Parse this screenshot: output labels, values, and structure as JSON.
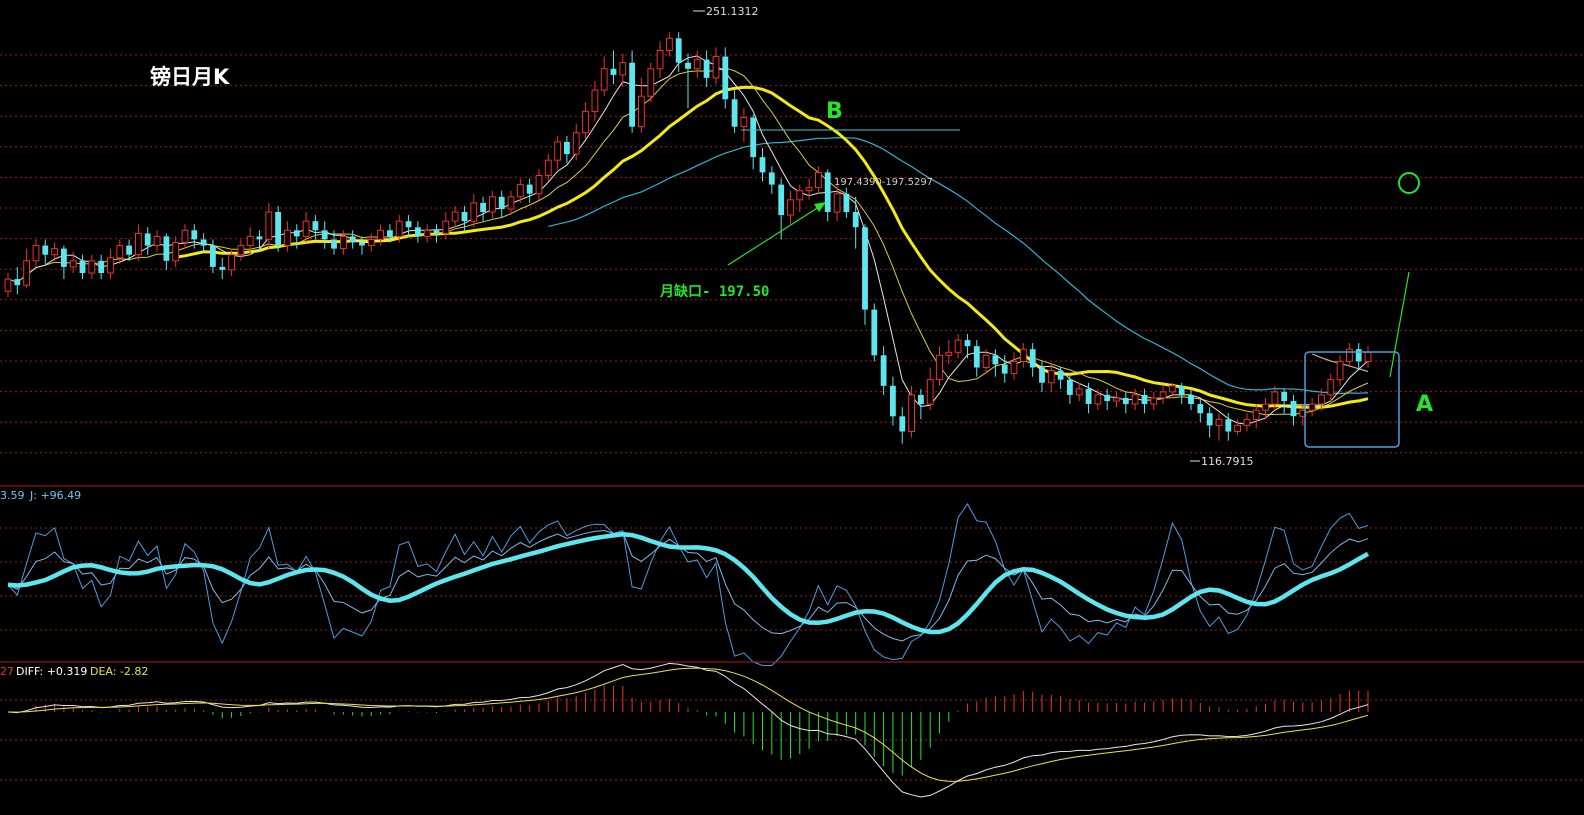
{
  "title": "镑日月K",
  "colors": {
    "background": "#000000",
    "grid": "#9b1c1c",
    "up_candle": "#e8342a",
    "down_candle": "#5ee6ee",
    "ma_white": "#e6e6e6",
    "ma_yellow_thin": "#d8cc3a",
    "ma_yellow_thick": "#f2ea12",
    "ma_blue": "#2fb3d4",
    "ma_grey": "#b9b29a",
    "annotation": "#23e628",
    "kdj_main": "#5ee6ee",
    "macd_pos": "#e8342a",
    "macd_neg": "#23e628"
  },
  "annotations": {
    "high_label": "251.1312",
    "low_label": "116.7915",
    "gap_range_label": "197.4390-197.5297",
    "gap_note": "月缺口- 197.50",
    "point_b": "B",
    "point_a": "A"
  },
  "indicators": {
    "kdj_label_prefix": "3.59",
    "kdj_label_j": "J: +96.49",
    "macd_label_prefix": "27",
    "macd_diff": "DIFF: +0.319",
    "macd_dea": "DEA: -2.82"
  },
  "chart_data": {
    "type": "candlestick",
    "title": "镑日月K",
    "price_range": [
      110,
      255
    ],
    "series_high": 251.1312,
    "series_low": 116.7915,
    "gap": [
      197.439,
      197.5297
    ],
    "candles": [
      [
        166,
        170,
        164,
        172
      ],
      [
        170,
        168,
        165,
        174
      ],
      [
        168,
        176,
        167,
        180
      ],
      [
        176,
        181,
        174,
        183
      ],
      [
        181,
        178,
        175,
        183
      ],
      [
        178,
        180,
        176,
        182
      ],
      [
        180,
        174,
        170,
        181
      ],
      [
        174,
        176,
        172,
        179
      ],
      [
        176,
        172,
        170,
        178
      ],
      [
        172,
        176,
        170,
        178
      ],
      [
        176,
        172,
        170,
        178
      ],
      [
        172,
        177,
        170,
        180
      ],
      [
        177,
        181,
        175,
        183
      ],
      [
        181,
        178,
        176,
        183
      ],
      [
        178,
        185,
        176,
        188
      ],
      [
        185,
        181,
        178,
        187
      ],
      [
        181,
        184,
        179,
        186
      ],
      [
        184,
        176,
        173,
        185
      ],
      [
        176,
        182,
        174,
        184
      ],
      [
        182,
        186,
        180,
        188
      ],
      [
        186,
        183,
        180,
        188
      ],
      [
        183,
        181,
        179,
        185
      ],
      [
        181,
        174,
        172,
        183
      ],
      [
        174,
        173,
        170,
        177
      ],
      [
        173,
        178,
        171,
        180
      ],
      [
        178,
        181,
        176,
        183
      ],
      [
        181,
        184,
        178,
        187
      ],
      [
        184,
        183,
        179,
        186
      ],
      [
        183,
        192,
        180,
        195
      ],
      [
        192,
        181,
        179,
        194
      ],
      [
        181,
        186,
        179,
        189
      ],
      [
        186,
        184,
        180,
        188
      ],
      [
        184,
        189,
        182,
        192
      ],
      [
        189,
        186,
        183,
        191
      ],
      [
        186,
        183,
        180,
        189
      ],
      [
        183,
        180,
        178,
        186
      ],
      [
        180,
        184,
        178,
        186
      ],
      [
        184,
        182,
        180,
        186
      ],
      [
        182,
        181,
        178,
        184
      ],
      [
        181,
        183,
        179,
        185
      ],
      [
        183,
        186,
        181,
        188
      ],
      [
        186,
        184,
        182,
        188
      ],
      [
        184,
        189,
        182,
        191
      ],
      [
        189,
        187,
        184,
        191
      ],
      [
        187,
        184,
        182,
        189
      ],
      [
        184,
        186,
        182,
        188
      ],
      [
        186,
        185,
        182,
        188
      ],
      [
        185,
        189,
        183,
        192
      ],
      [
        189,
        192,
        187,
        194
      ],
      [
        192,
        189,
        186,
        194
      ],
      [
        189,
        195,
        187,
        198
      ],
      [
        195,
        192,
        189,
        197
      ],
      [
        192,
        197,
        190,
        199
      ],
      [
        197,
        193,
        190,
        199
      ],
      [
        193,
        197,
        191,
        199
      ],
      [
        197,
        201,
        195,
        203
      ],
      [
        201,
        198,
        195,
        203
      ],
      [
        198,
        204,
        196,
        206
      ],
      [
        204,
        209,
        202,
        211
      ],
      [
        209,
        215,
        206,
        217
      ],
      [
        215,
        211,
        208,
        217
      ],
      [
        211,
        218,
        209,
        221
      ],
      [
        218,
        225,
        216,
        228
      ],
      [
        225,
        232,
        222,
        235
      ],
      [
        232,
        239,
        230,
        243
      ],
      [
        239,
        237,
        234,
        245
      ],
      [
        237,
        241,
        233,
        244
      ],
      [
        241,
        220,
        218,
        245
      ],
      [
        220,
        230,
        218,
        236
      ],
      [
        230,
        239,
        228,
        241
      ],
      [
        239,
        245,
        236,
        248
      ],
      [
        245,
        249,
        243,
        251
      ],
      [
        249,
        241,
        238,
        251
      ],
      [
        241,
        239,
        226,
        244
      ],
      [
        239,
        242,
        236,
        245
      ],
      [
        242,
        236,
        233,
        245
      ],
      [
        236,
        243,
        234,
        246
      ],
      [
        243,
        229,
        226,
        246
      ],
      [
        229,
        220,
        218,
        232
      ],
      [
        220,
        223,
        215,
        226
      ],
      [
        223,
        210,
        206,
        224
      ],
      [
        210,
        205,
        202,
        213
      ],
      [
        205,
        201,
        198,
        207
      ],
      [
        201,
        191,
        183,
        203
      ],
      [
        191,
        196,
        188,
        199
      ],
      [
        196,
        199,
        192,
        201
      ],
      [
        199,
        200,
        196,
        203
      ],
      [
        200,
        205,
        198,
        207
      ],
      [
        205,
        192,
        189,
        206
      ],
      [
        192,
        198,
        189,
        201
      ],
      [
        198,
        192,
        190,
        200
      ],
      [
        192,
        187,
        180,
        197
      ],
      [
        187,
        160,
        155,
        188
      ],
      [
        160,
        145,
        143,
        162
      ],
      [
        145,
        135,
        132,
        148
      ],
      [
        135,
        125,
        122,
        138
      ],
      [
        125,
        120,
        116,
        128
      ],
      [
        120,
        132,
        118,
        135
      ],
      [
        132,
        129,
        124,
        134
      ],
      [
        129,
        137,
        127,
        141
      ],
      [
        137,
        145,
        135,
        148
      ],
      [
        145,
        146,
        142,
        150
      ],
      [
        146,
        150,
        144,
        152
      ],
      [
        150,
        148,
        144,
        152
      ],
      [
        148,
        141,
        138,
        150
      ],
      [
        141,
        145,
        139,
        147
      ],
      [
        145,
        142,
        138,
        147
      ],
      [
        142,
        139,
        136,
        145
      ],
      [
        139,
        143,
        137,
        146
      ],
      [
        143,
        147,
        141,
        149
      ],
      [
        147,
        141,
        138,
        149
      ],
      [
        141,
        136,
        133,
        143
      ],
      [
        136,
        140,
        133,
        142
      ],
      [
        140,
        137,
        134,
        141
      ],
      [
        137,
        132,
        129,
        139
      ],
      [
        132,
        134,
        130,
        136
      ],
      [
        134,
        129,
        126,
        136
      ],
      [
        129,
        132,
        127,
        134
      ],
      [
        132,
        130,
        127,
        134
      ],
      [
        130,
        131,
        128,
        133
      ],
      [
        131,
        129,
        126,
        133
      ],
      [
        129,
        132,
        127,
        134
      ],
      [
        132,
        129,
        126,
        134
      ],
      [
        129,
        131,
        127,
        133
      ],
      [
        131,
        133,
        129,
        135
      ],
      [
        133,
        135,
        131,
        136
      ],
      [
        135,
        132,
        129,
        136
      ],
      [
        132,
        129,
        127,
        134
      ],
      [
        129,
        126,
        123,
        131
      ],
      [
        126,
        122,
        118,
        128
      ],
      [
        122,
        124,
        117,
        126
      ],
      [
        124,
        120,
        117,
        126
      ],
      [
        120,
        122,
        119,
        124
      ],
      [
        122,
        124,
        120,
        126
      ],
      [
        124,
        127,
        121,
        129
      ],
      [
        127,
        129,
        124,
        131
      ],
      [
        129,
        133,
        127,
        135
      ],
      [
        133,
        130,
        126,
        134
      ],
      [
        130,
        125,
        122,
        132
      ],
      [
        125,
        127,
        122,
        129
      ],
      [
        127,
        129,
        125,
        131
      ],
      [
        129,
        132,
        127,
        134
      ],
      [
        132,
        137,
        130,
        139
      ],
      [
        137,
        143,
        135,
        145
      ],
      [
        143,
        147,
        141,
        149
      ],
      [
        147,
        143,
        140,
        149
      ],
      [
        143,
        146,
        141,
        148
      ]
    ]
  }
}
